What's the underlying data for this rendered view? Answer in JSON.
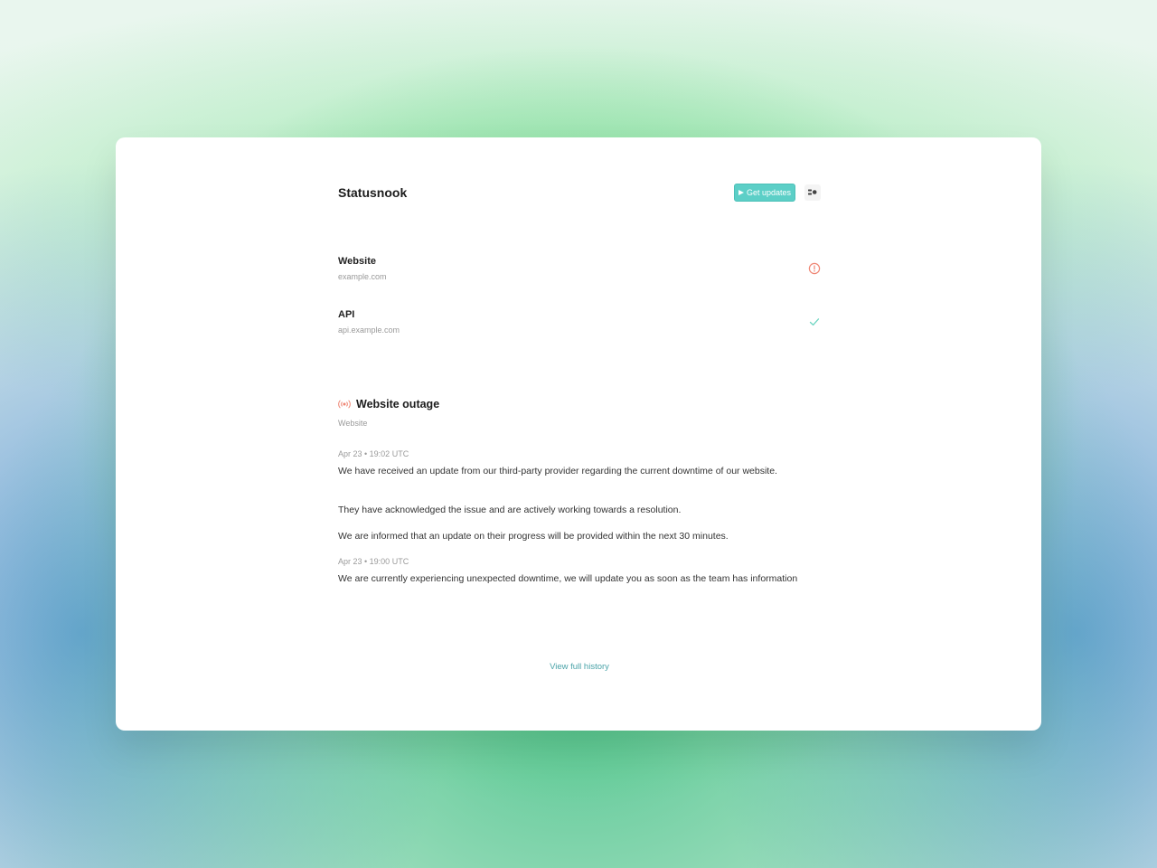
{
  "header": {
    "brand": "Statusnook",
    "get_updates_label": "Get updates",
    "accent_color": "#5ccfc7"
  },
  "services": [
    {
      "name": "Website",
      "host": "example.com",
      "status": "outage",
      "status_icon": "alert-circle-icon",
      "status_color": "#ef8674"
    },
    {
      "name": "API",
      "host": "api.example.com",
      "status": "operational",
      "status_icon": "check-icon",
      "status_color": "#6fd6c2"
    }
  ],
  "incident": {
    "title": "Website outage",
    "service": "Website",
    "icon": "broadcast-icon",
    "updates": [
      {
        "time": "Apr 23 • 19:02 UTC",
        "paragraphs": [
          "We have received an update from our third-party provider regarding the current downtime of our website.",
          "They have acknowledged the issue and are actively working towards a resolution.",
          "We are informed that an update on their progress will be provided within the next 30 minutes."
        ]
      },
      {
        "time": "Apr 23 • 19:00 UTC",
        "paragraphs": [
          "We are currently experiencing unexpected downtime, we will update you as soon as the team has information"
        ]
      }
    ]
  },
  "footer": {
    "history_label": "View full history"
  }
}
